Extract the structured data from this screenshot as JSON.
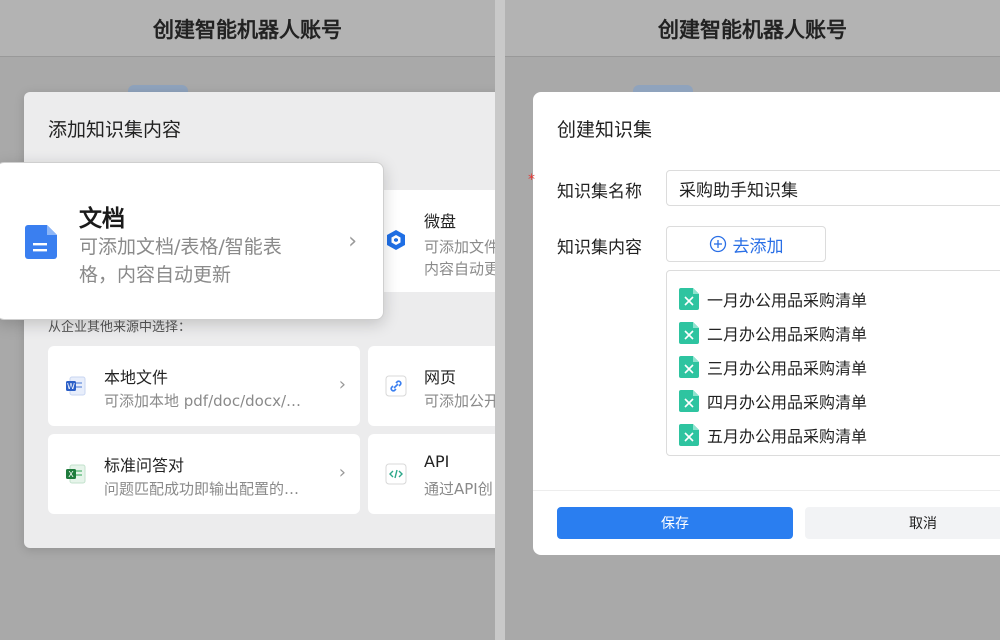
{
  "header": {
    "title": "创建智能机器人账号"
  },
  "add_modal": {
    "title": "添加知识集内容",
    "doc_card": {
      "name": "文档",
      "desc": "可添加文档/表格/智能表格，内容自动更新"
    },
    "weipan_card": {
      "name": "微盘",
      "desc": "可添加文件",
      "desc2": "内容自动更"
    },
    "section_label": "从企业其他来源中选择：",
    "local_card": {
      "name": "本地文件",
      "desc": "可添加本地 pdf/doc/docx/…"
    },
    "web_card": {
      "name": "网页",
      "desc": "可添加公开"
    },
    "qa_card": {
      "name": "标准问答对",
      "desc": "问题匹配成功即输出配置的…"
    },
    "api_card": {
      "name": "API",
      "desc": "通过API创"
    }
  },
  "create_modal": {
    "title": "创建知识集",
    "required_mark": "*",
    "name_label": "知识集名称",
    "name_value": "采购助手知识集",
    "content_label": "知识集内容",
    "add_label": "去添加",
    "files": [
      "一月办公用品采购清单",
      "二月办公用品采购清单",
      "三月办公用品采购清单",
      "四月办公用品采购清单",
      "五月办公用品采购清单"
    ],
    "save_label": "保存",
    "cancel_label": "取消"
  },
  "colors": {
    "accent": "#2a7ef0",
    "sheet_icon": "#2ec4a0",
    "doc_icon": "#3a7ff0"
  }
}
